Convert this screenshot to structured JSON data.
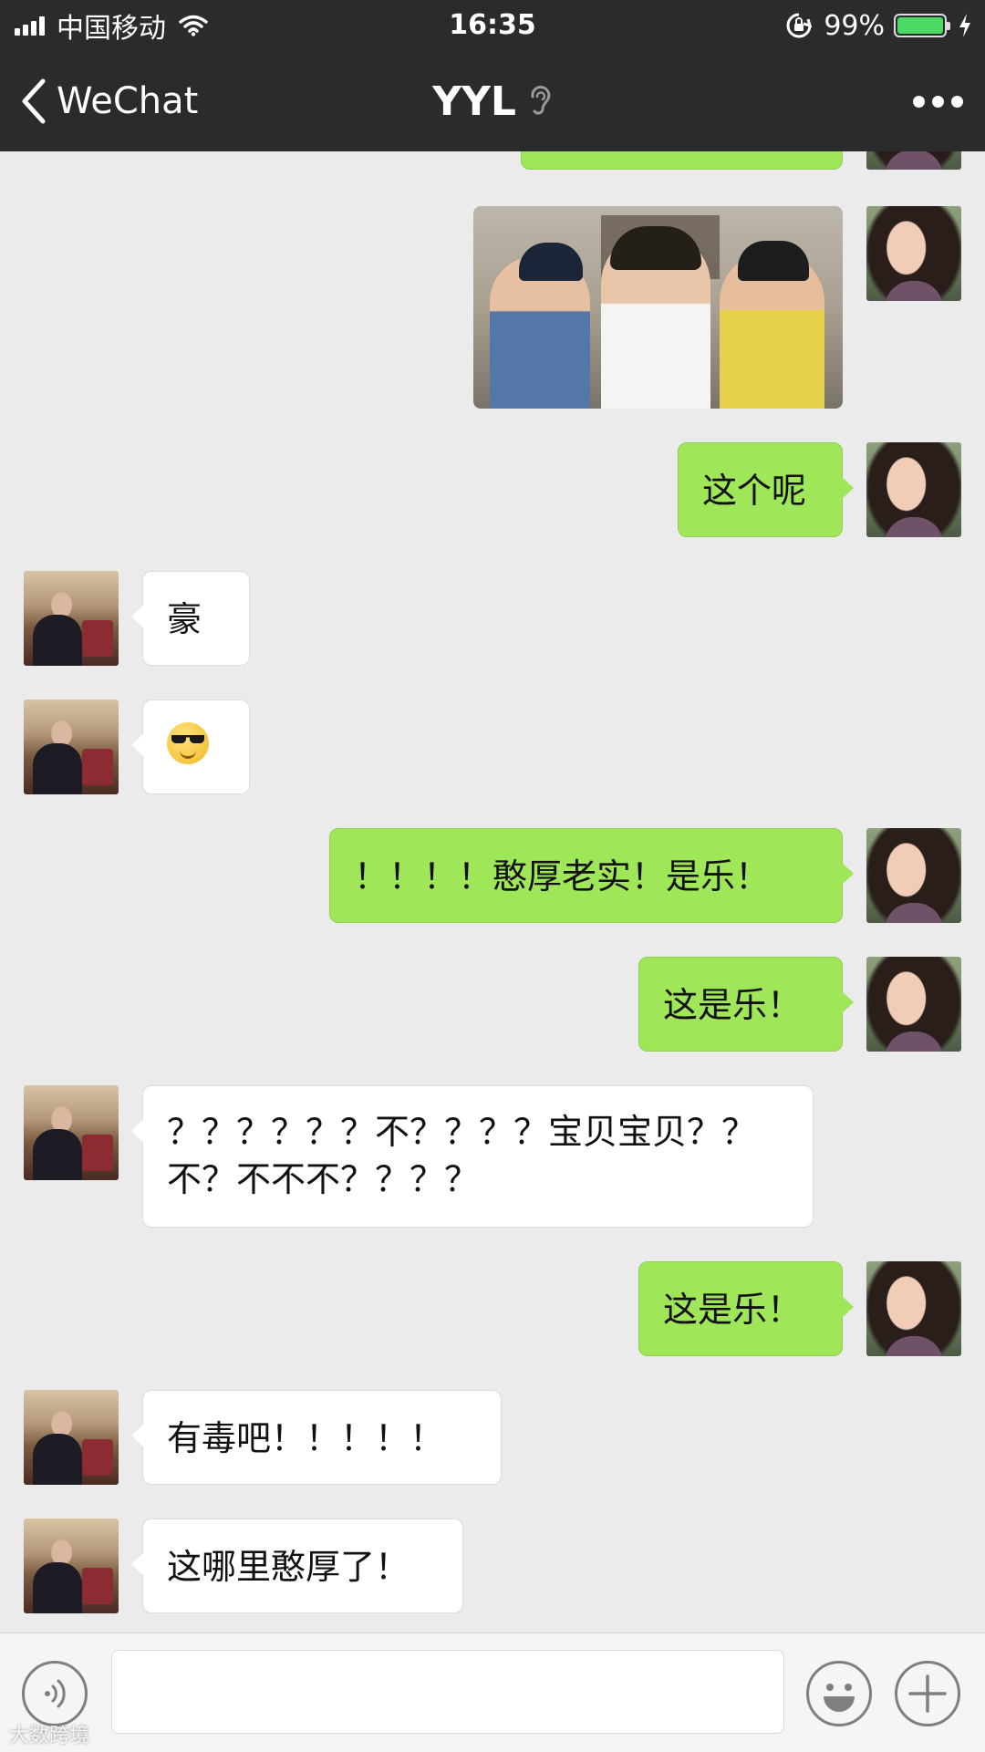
{
  "status_bar": {
    "carrier": "中国移动",
    "time": "16:35",
    "battery_percent": "99%",
    "battery_level": 0.99,
    "battery_color": "#4cd964"
  },
  "nav": {
    "back_label": "WeChat",
    "title": "YYL",
    "icons": [
      "chevron-left-icon",
      "ear-icon",
      "more-icon"
    ]
  },
  "colors": {
    "my_bubble": "#9fe658",
    "their_bubble": "#ffffff",
    "chat_background": "#ebebeb",
    "bar_background": "#2b2b2b"
  },
  "messages": [
    {
      "from": "me",
      "type": "image"
    },
    {
      "from": "me",
      "type": "text",
      "text": "这个呢"
    },
    {
      "from": "them",
      "type": "text",
      "text": "豪"
    },
    {
      "from": "them",
      "type": "emoji",
      "emoji": "sunglasses-smile-emoji"
    },
    {
      "from": "me",
      "type": "text",
      "text": "！！！！憨厚老实！是乐！"
    },
    {
      "from": "me",
      "type": "text",
      "text": "这是乐！"
    },
    {
      "from": "them",
      "type": "text",
      "text": "？？？？？？不？？？？宝贝宝贝？？不？不不不？？？？"
    },
    {
      "from": "me",
      "type": "text",
      "text": "这是乐！"
    },
    {
      "from": "them",
      "type": "text",
      "text": "有毒吧！！！！！"
    },
    {
      "from": "them",
      "type": "text",
      "text": "这哪里憨厚了！"
    }
  ],
  "input_bar": {
    "placeholder": "",
    "icons": [
      "voice-icon",
      "emoji-icon",
      "plus-icon"
    ]
  },
  "watermark": "大数跨境"
}
